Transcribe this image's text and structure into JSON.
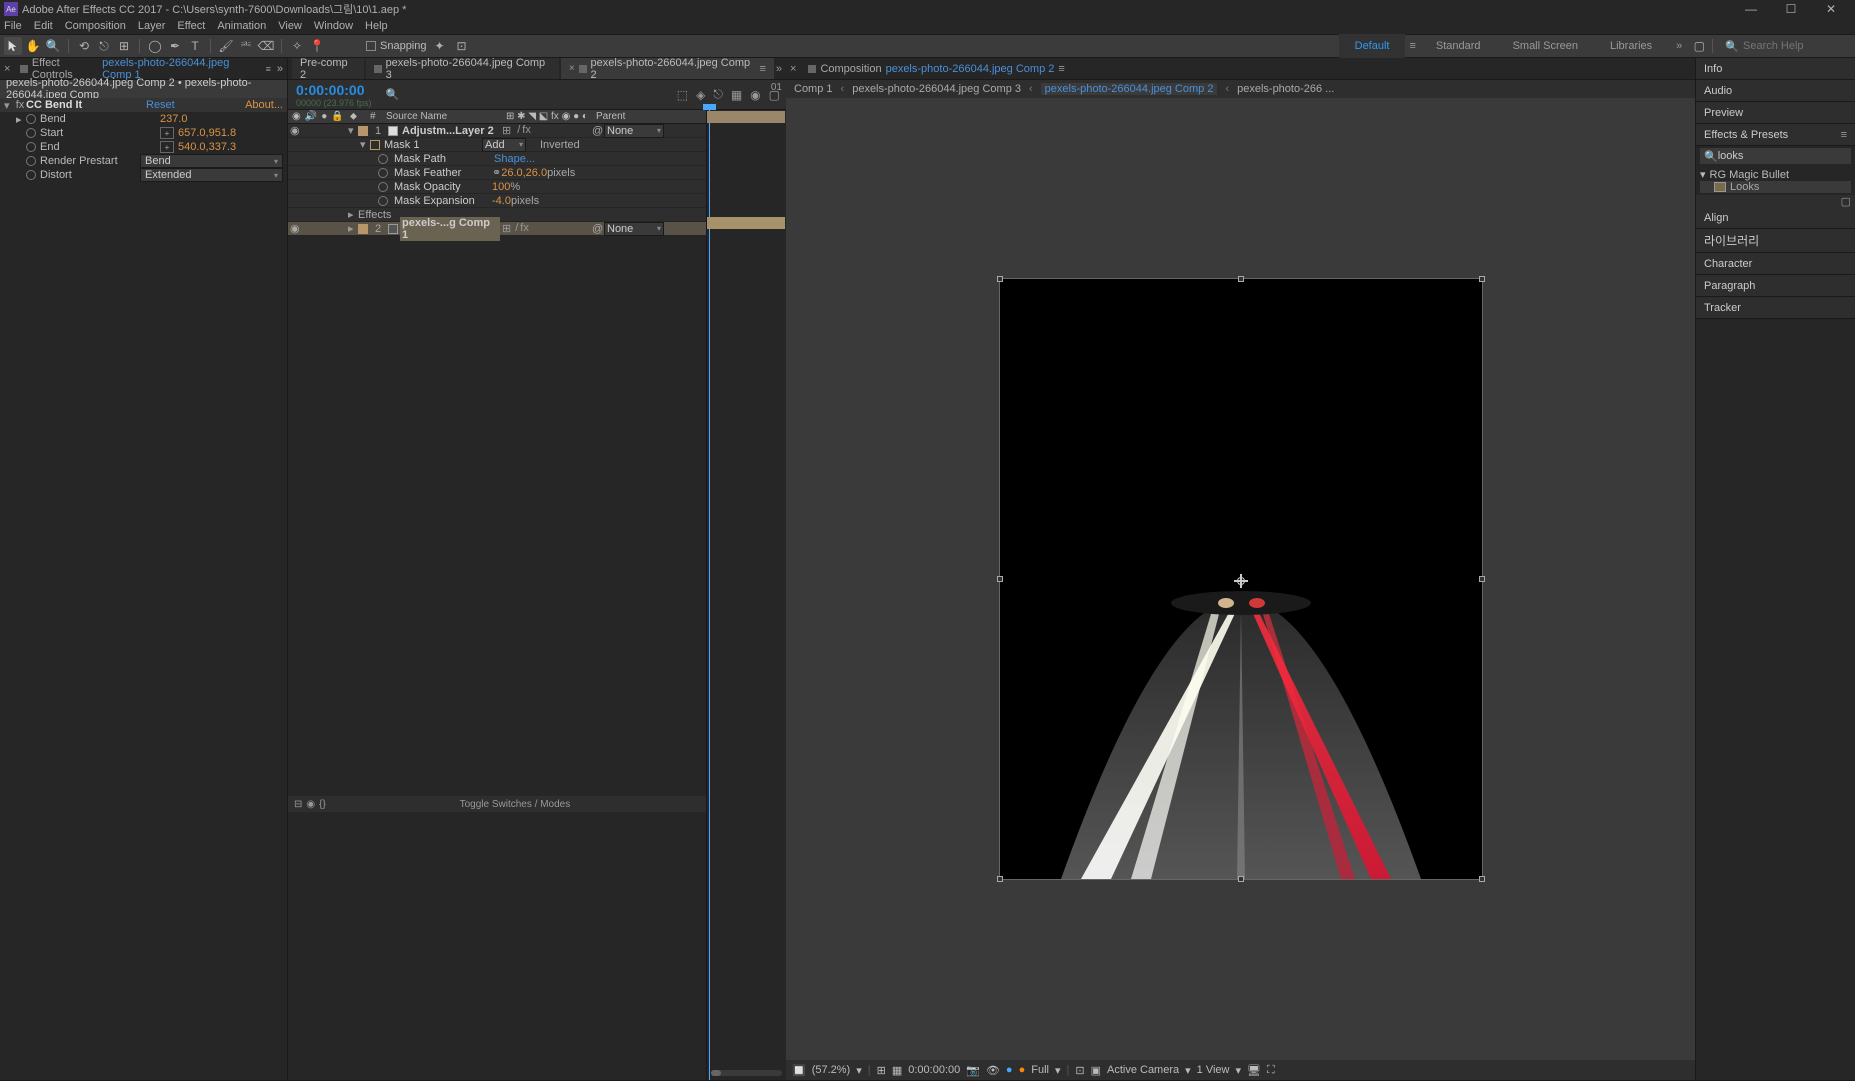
{
  "titlebar": {
    "app_badge": "Ae",
    "title": "Adobe After Effects CC 2017 - C:\\Users\\synth-7600\\Downloads\\그림\\10\\1.aep *"
  },
  "menubar": [
    "File",
    "Edit",
    "Composition",
    "Layer",
    "Effect",
    "Animation",
    "View",
    "Window",
    "Help"
  ],
  "toolbar": {
    "snapping_label": "Snapping"
  },
  "workspaces": {
    "items": [
      "Default",
      "Standard",
      "Small Screen",
      "Libraries"
    ],
    "active": 0,
    "search_placeholder": "Search Help"
  },
  "effect_controls": {
    "tab_prefix": "Effect Controls",
    "tab_link": "pexels-photo-266044.jpeg Comp 1",
    "header": "pexels-photo-266044.jpeg Comp 2 • pexels-photo-266044.jpeg Comp",
    "effect_name": "CC Bend It",
    "reset": "Reset",
    "about": "About...",
    "rows": [
      {
        "name": "Bend",
        "value": "237.0",
        "type": "num"
      },
      {
        "name": "Start",
        "value": "657.0,951.8",
        "type": "point"
      },
      {
        "name": "End",
        "value": "540.0,337.3",
        "type": "point"
      },
      {
        "name": "Render Prestart",
        "value": "Bend",
        "type": "drop"
      },
      {
        "name": "Distort",
        "value": "Extended",
        "type": "drop"
      }
    ]
  },
  "timeline": {
    "tabs": [
      {
        "label": "Pre-comp 2",
        "active": false,
        "closeable": false
      },
      {
        "label": "pexels-photo-266044.jpeg Comp 3",
        "active": false,
        "closeable": true
      },
      {
        "label": "pexels-photo-266044.jpeg Comp 2",
        "active": true,
        "closeable": true
      }
    ],
    "timecode": "0:00:00:00",
    "timecode_sub": "00000 (23.976 fps)",
    "col_source": "Source Name",
    "col_parent": "Parent",
    "layers": [
      {
        "num": "1",
        "name": "Adjustm...Layer 2",
        "parent": "None",
        "selected": false,
        "mask": {
          "name": "Mask 1",
          "mode": "Add",
          "inverted": "Inverted"
        },
        "props": [
          {
            "name": "Mask Path",
            "value": "Shape..."
          },
          {
            "name": "Mask Feather",
            "value": "26.0,26.0",
            "suffix": " pixels",
            "link": true
          },
          {
            "name": "Mask Opacity",
            "value": "100",
            "suffix": "%"
          },
          {
            "name": "Mask Expansion",
            "value": "-4.0",
            "suffix": " pixels"
          }
        ],
        "effects_label": "Effects"
      },
      {
        "num": "2",
        "name": "pexels-...g Comp 1",
        "parent": "None",
        "selected": true
      }
    ],
    "bottom_label": "Toggle Switches / Modes",
    "ruler_end": "01"
  },
  "viewer": {
    "tab_prefix": "Composition",
    "tab_link": "pexels-photo-266044.jpeg Comp 2",
    "breadcrumbs": [
      {
        "label": "Comp 1"
      },
      {
        "label": "pexels-photo-266044.jpeg Comp 3"
      },
      {
        "label": "pexels-photo-266044.jpeg Comp 2",
        "active": true
      },
      {
        "label": "pexels-photo-266 ..."
      }
    ],
    "bottom": {
      "zoom": "(57.2%)",
      "timecode": "0:00:00:00",
      "res": "Full",
      "camera": "Active Camera",
      "views": "1 View"
    }
  },
  "right_panels": {
    "info": "Info",
    "audio": "Audio",
    "preview": "Preview",
    "effects_presets": "Effects & Presets",
    "search_value": "looks",
    "folder": "RG Magic Bullet",
    "preset": "Looks",
    "align": "Align",
    "library": "라이브러리",
    "character": "Character",
    "paragraph": "Paragraph",
    "tracker": "Tracker"
  }
}
